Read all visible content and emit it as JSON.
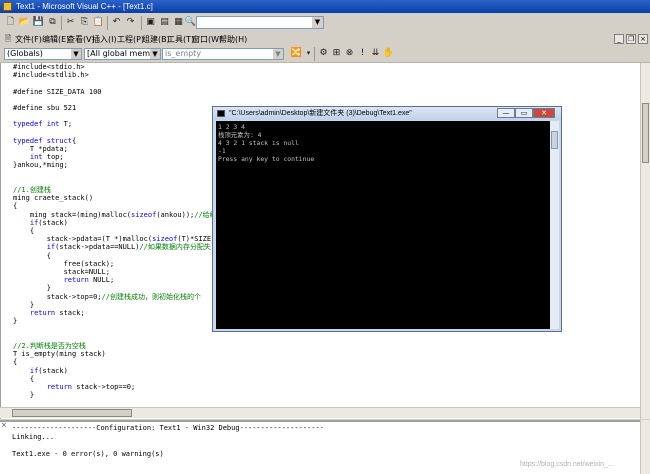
{
  "window": {
    "title": "Text1 - Microsoft Visual C++ - [Text1.c]"
  },
  "toolbar": {
    "icons": [
      "new-file-icon",
      "open-folder-icon",
      "save-icon",
      "save-all-icon",
      "cut-icon",
      "copy-icon",
      "paste-icon",
      "undo-icon",
      "redo-icon",
      "workspace-icon",
      "output-window-icon",
      "window-list-icon",
      "find-in-files-icon"
    ],
    "find_value": ""
  },
  "menu": {
    "items": [
      "文件(F)",
      "编辑(E)",
      "查看(V)",
      "插入(I)",
      "工程(P)",
      "组建(B)",
      "工具(T)",
      "窗口(W)",
      "帮助(H)"
    ],
    "mdi_controls": [
      "_",
      "❐",
      "×"
    ]
  },
  "wizardbar": {
    "class_combo": "(Globals)",
    "filter_combo": "[All global members",
    "member_combo": "is_empty"
  },
  "editor": {
    "lines": [
      [
        [
          "pp",
          "#include<stdio.h>"
        ]
      ],
      [
        [
          "pp",
          "#include<stdlib.h>"
        ]
      ],
      [],
      [
        [
          "pp",
          "#define SIZE_DATA 100"
        ]
      ],
      [],
      [
        [
          "pp",
          "#define sbu 521"
        ]
      ],
      [],
      [
        [
          "kw",
          "typedef"
        ],
        [
          "t",
          " "
        ],
        [
          "kw",
          "int"
        ],
        [
          "t",
          " T;"
        ]
      ],
      [],
      [
        [
          "kw",
          "typedef"
        ],
        [
          "t",
          " "
        ],
        [
          "kw",
          "struct"
        ],
        [
          "t",
          "{"
        ]
      ],
      [
        [
          "t",
          "    T *pdata;"
        ]
      ],
      [
        [
          "t",
          "    "
        ],
        [
          "kw",
          "int"
        ],
        [
          "t",
          " top;"
        ]
      ],
      [
        [
          "t",
          "}ankou,*ming;"
        ]
      ],
      [],
      [],
      [
        [
          "cm",
          "//1.创建栈"
        ]
      ],
      [
        [
          "t",
          "ming craete_stack()"
        ]
      ],
      [
        [
          "t",
          "{"
        ]
      ],
      [
        [
          "t",
          "    ming stack=(ming)malloc("
        ],
        [
          "kw",
          "sizeof"
        ],
        [
          "t",
          "(ankou));"
        ],
        [
          "cm",
          "//给结"
        ]
      ],
      [
        [
          "t",
          "    "
        ],
        [
          "kw",
          "if"
        ],
        [
          "t",
          "(stack)"
        ]
      ],
      [
        [
          "t",
          "    {"
        ]
      ],
      [
        [
          "t",
          "        stack->pdata=(T *)malloc("
        ],
        [
          "kw",
          "sizeof"
        ],
        [
          "t",
          "(T)*SIZE_D"
        ]
      ],
      [
        [
          "t",
          "        "
        ],
        [
          "kw",
          "if"
        ],
        [
          "t",
          "(stack->pdata==NULL)"
        ],
        [
          "cm",
          "//如果数据内存分配失"
        ]
      ],
      [
        [
          "t",
          "        {"
        ]
      ],
      [
        [
          "t",
          "            free(stack);"
        ]
      ],
      [
        [
          "t",
          "            stack=NULL;"
        ]
      ],
      [
        [
          "t",
          "            "
        ],
        [
          "kw",
          "return"
        ],
        [
          "t",
          " NULL;"
        ]
      ],
      [
        [
          "t",
          "        }"
        ]
      ],
      [
        [
          "t",
          "        stack->top=0;"
        ],
        [
          "cm",
          "//创建栈成功，则初始化栈的个"
        ]
      ],
      [
        [
          "t",
          "    }"
        ]
      ],
      [
        [
          "t",
          "    "
        ],
        [
          "kw",
          "return"
        ],
        [
          "t",
          " stack;"
        ]
      ],
      [
        [
          "t",
          "}"
        ]
      ],
      [],
      [],
      [
        [
          "cm",
          "//2.判断栈是否为空栈"
        ]
      ],
      [
        [
          "t",
          "T is_empty(ming stack)"
        ]
      ],
      [
        [
          "t",
          "{"
        ]
      ],
      [
        [
          "t",
          "    "
        ],
        [
          "kw",
          "if"
        ],
        [
          "t",
          "(stack)"
        ]
      ],
      [
        [
          "t",
          "    {"
        ]
      ],
      [
        [
          "t",
          "        "
        ],
        [
          "kw",
          "return"
        ],
        [
          "t",
          " stack->top==0;"
        ]
      ],
      [
        [
          "t",
          "    }"
        ]
      ]
    ]
  },
  "console": {
    "title": "\"C:\\Users\\admin\\Desktop\\新建文件夹 (3)\\Debug\\Text1.exe\"",
    "buttons": [
      "—",
      "▭",
      "✕"
    ],
    "lines": [
      "1 2 3 4",
      "栈顶元素为: 4",
      "4 3 2 1 stack is null",
      "-1",
      "Press any key to continue"
    ]
  },
  "output": {
    "lines": [
      "--------------------Configuration: Text1 - Win32 Debug--------------------",
      "Linking...",
      "",
      "Text1.exe - 0 error(s), 0 warning(s)"
    ],
    "close_glyph": "×"
  },
  "watermark": "https://blog.csdn.net/weixin_..."
}
